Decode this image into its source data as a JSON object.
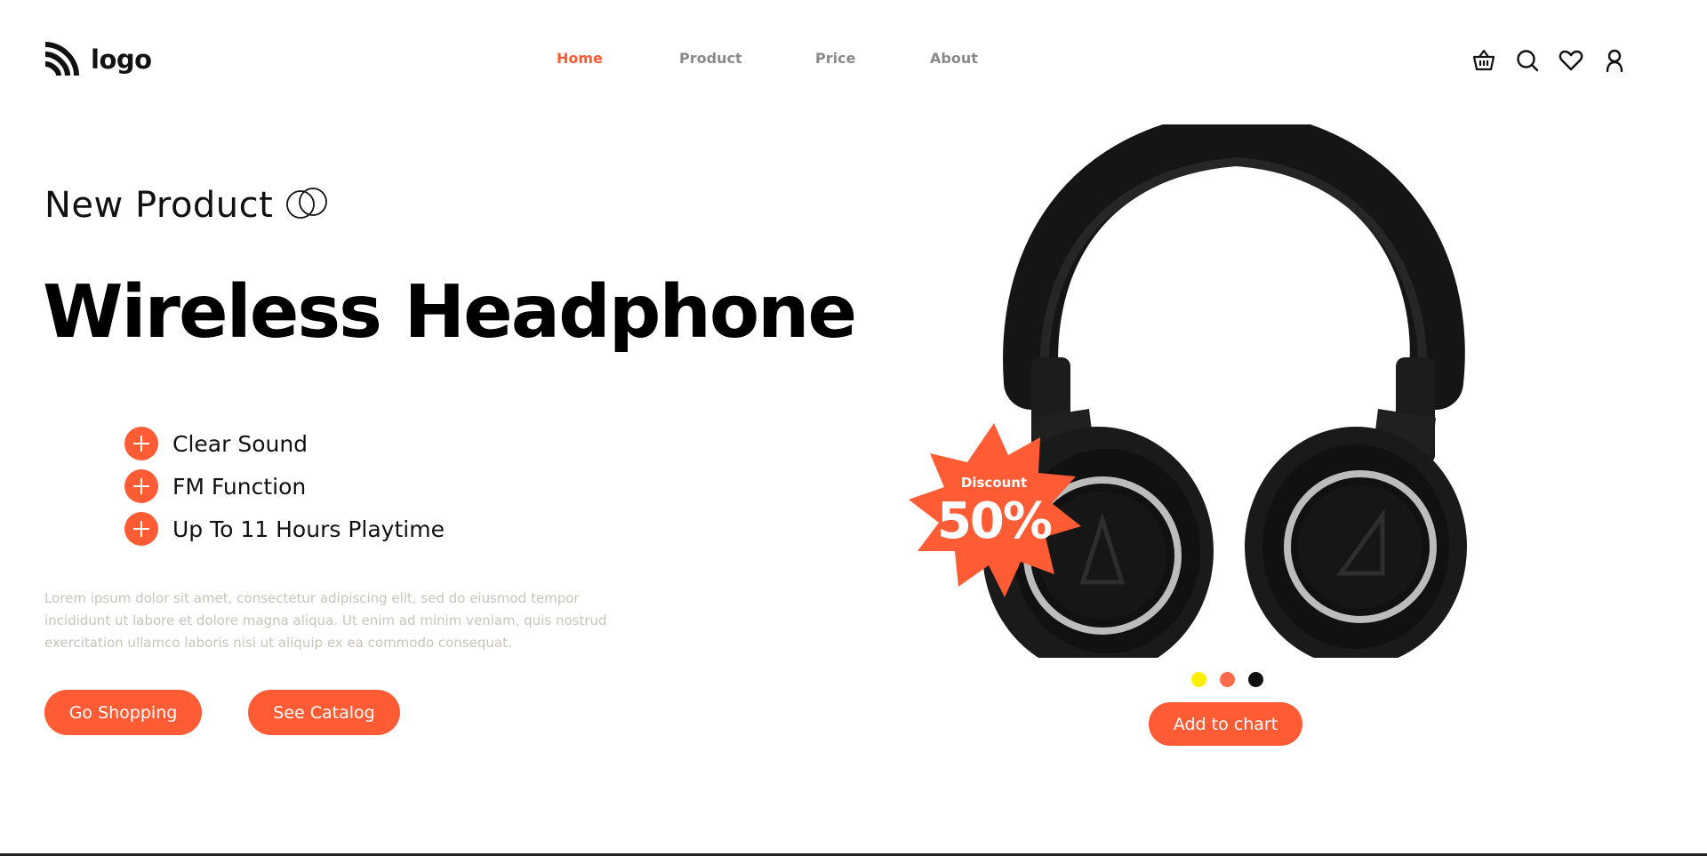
{
  "header": {
    "logo_text": "logo",
    "nav": [
      {
        "label": "Home",
        "active": true
      },
      {
        "label": "Product",
        "active": false
      },
      {
        "label": "Price",
        "active": false
      },
      {
        "label": "About",
        "active": false
      }
    ],
    "icons": [
      "basket-icon",
      "search-icon",
      "heart-icon",
      "user-icon"
    ]
  },
  "hero": {
    "subtitle": "New Product",
    "title": "Wireless Headphone",
    "features": [
      "Clear Sound",
      "FM Function",
      "Up To 11 Hours Playtime"
    ],
    "description": "Lorem ipsum dolor sit amet, consectetur adipiscing elit, sed do eiusmod tempor incididunt ut labore et dolore magna aliqua. Ut enim ad minim veniam, quis nostrud exercitation ullamco laboris nisi ut aliquip ex ea commodo consequat.",
    "buttons": {
      "shop": "Go Shopping",
      "catalog": "See Catalog"
    }
  },
  "product": {
    "badge_label": "Discount",
    "badge_value": "50%",
    "colors": [
      "#ffee00",
      "#ff6a4a",
      "#111111"
    ],
    "cart_button": "Add to chart"
  },
  "theme": {
    "accent": "#ff5c35",
    "nav_inactive": "#8a8a8a",
    "description_text": "#c9c4bb"
  }
}
